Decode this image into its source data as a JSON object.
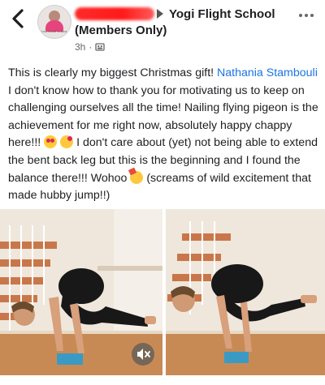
{
  "header": {
    "back_icon": "chevron-left-icon",
    "avatar_caption": "YOGI FLIGHT SCHOOL",
    "group_name": "Yogi Flight School",
    "group_subtitle": "(Members Only)",
    "timestamp": "3h",
    "separator": "·",
    "privacy_icon": "members-icon",
    "more_icon": "more-horizontal-icon",
    "redaction_color": "#ff2020"
  },
  "post": {
    "text_1": "This is clearly my biggest Christmas gift! ",
    "mention": "Nathania Stambouli",
    "text_2": " I don't know how to thank you for motivating us to keep on challenging  ourselves all the time! Nailing flying pigeon is the achievement for me right now, absolutely happy chappy here!!! ",
    "emoji_1": "star-struck-emoji",
    "emoji_2": "smiling-face-with-hearts-emoji",
    "text_3": " I don't care about (yet) not being able to extend the bent back leg but this is the beginning and I found the balance there!!! Wohoo ",
    "emoji_3": "partying-face-emoji",
    "text_4": " (screams of wild excitement that made hubby jump!!)",
    "mention_color": "#1b74e4"
  },
  "media": {
    "left_photo": "yoga-flying-pigeon-photo-left",
    "right_photo": "yoga-flying-pigeon-photo-right",
    "mute_icon": "speaker-muted-icon"
  }
}
